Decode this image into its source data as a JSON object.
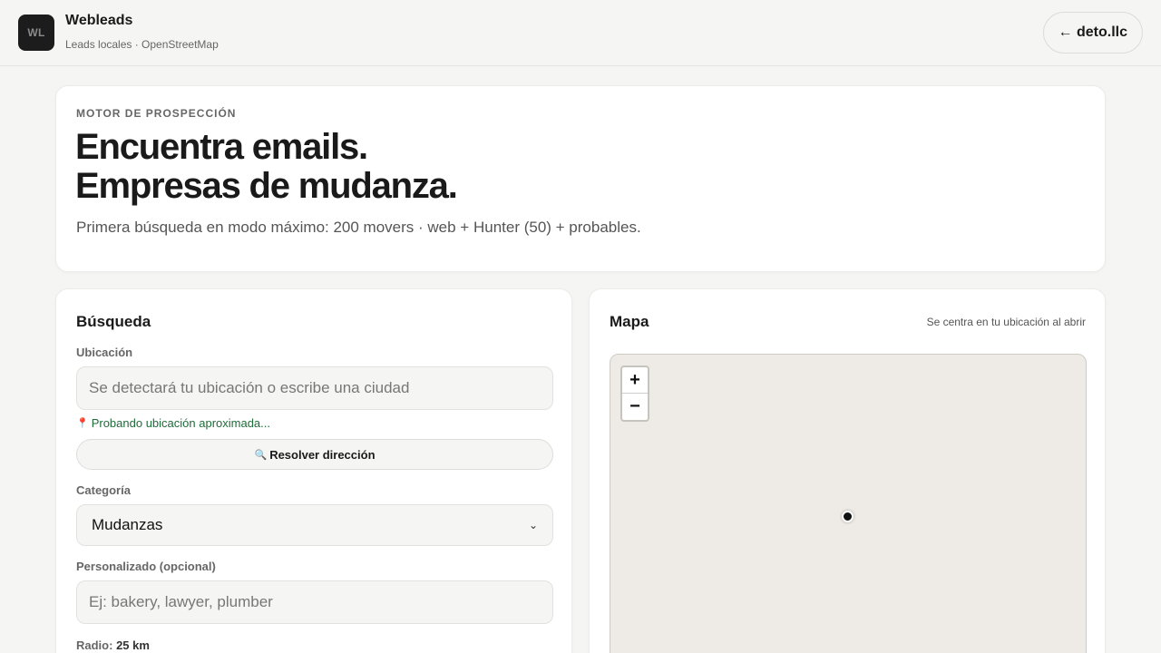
{
  "header": {
    "logo_text": "WL",
    "title": "Webleads",
    "subtitle": "Leads locales · OpenStreetMap",
    "back_label": "← deto.llc"
  },
  "hero": {
    "eyebrow": "MOTOR DE PROSPECCIÓN",
    "headline_1": "Encuentra emails.",
    "headline_2": "Empresas de mudanza.",
    "subtitle": "Primera búsqueda en modo máximo: 200 movers · web + Hunter (50) + probables."
  },
  "search": {
    "title": "Búsqueda",
    "location_label": "Ubicación",
    "location_placeholder": "Se detectará tu ubicación o escribe una ciudad",
    "location_status": "Probando ubicación aproximada...",
    "resolve_label": "Resolver dirección",
    "category_label": "Categoría",
    "category_value": "Mudanzas",
    "custom_label": "Personalizado (opcional)",
    "custom_placeholder": "Ej: bakery, lawyer, plumber",
    "radius_label": "Radio:",
    "radius_value": "25 km"
  },
  "map": {
    "title": "Mapa",
    "note": "Se centra en tu ubicación al abrir",
    "zoom_in": "+",
    "zoom_out": "−"
  },
  "colors": {
    "background": "#f5f5f3",
    "status_green": "#1f6b3a",
    "map_bg": "#eeebe6"
  },
  "icons": {
    "pin": "pin-icon",
    "search": "magnifier-icon",
    "chevron": "chevron-down-icon"
  }
}
